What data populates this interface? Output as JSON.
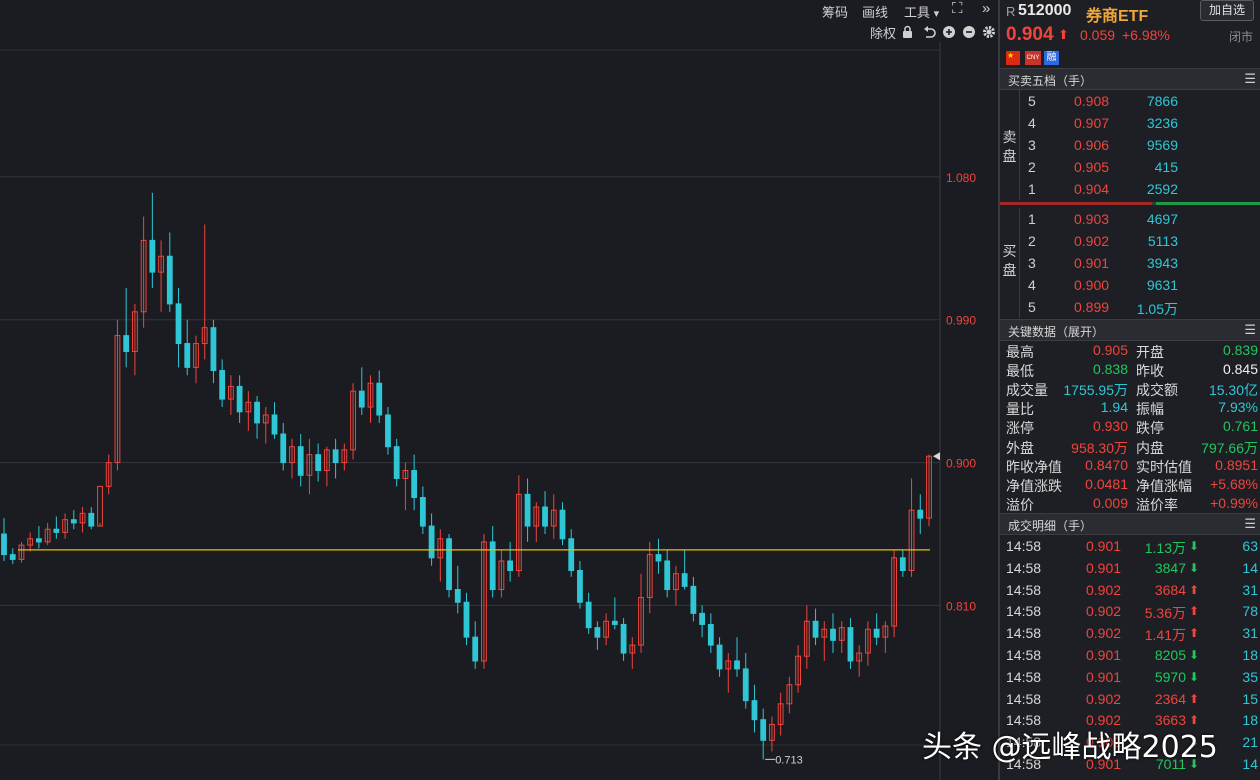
{
  "toolbar": {
    "chips": "筹码",
    "draw": "画线",
    "tools": "工具",
    "tools_arrow": "▾",
    "fullscreen_icon": "⛶",
    "more_icon": "»"
  },
  "subbar": {
    "adjust": "除权",
    "icons": [
      "lock-icon",
      "undo-icon",
      "zoom-in-icon",
      "zoom-out-icon",
      "gear-icon"
    ]
  },
  "chart_data": {
    "type": "candlestick",
    "y_ticks": [
      "1.080",
      "0.990",
      "0.900",
      "0.810"
    ],
    "y_tick_values": [
      1.08,
      0.99,
      0.9,
      0.81
    ],
    "ylim": [
      0.7,
      1.165
    ],
    "reference_price": 0.845,
    "low_marker": "0.713",
    "last_price_marker": 0.904,
    "up_color": "#f0443c",
    "down_color": "#2fc7d6",
    "ref_line_color": "#e8c000",
    "grid": true,
    "candles": [
      [
        0.855,
        0.865,
        0.838,
        0.842
      ],
      [
        0.842,
        0.846,
        0.836,
        0.839
      ],
      [
        0.839,
        0.85,
        0.837,
        0.848
      ],
      [
        0.848,
        0.856,
        0.844,
        0.852
      ],
      [
        0.852,
        0.86,
        0.846,
        0.85
      ],
      [
        0.85,
        0.862,
        0.848,
        0.858
      ],
      [
        0.858,
        0.866,
        0.852,
        0.856
      ],
      [
        0.856,
        0.868,
        0.852,
        0.864
      ],
      [
        0.864,
        0.87,
        0.858,
        0.862
      ],
      [
        0.862,
        0.872,
        0.856,
        0.868
      ],
      [
        0.868,
        0.872,
        0.858,
        0.86
      ],
      [
        0.86,
        0.862,
        0.882,
        0.885
      ],
      [
        0.885,
        0.905,
        0.88,
        0.9
      ],
      [
        0.9,
        0.99,
        0.895,
        0.98
      ],
      [
        0.98,
        1.01,
        0.96,
        0.97
      ],
      [
        0.97,
        1.0,
        0.955,
        0.995
      ],
      [
        0.995,
        1.055,
        0.985,
        1.04
      ],
      [
        1.04,
        1.07,
        1.01,
        1.02
      ],
      [
        1.02,
        1.04,
        0.995,
        1.03
      ],
      [
        1.03,
        1.045,
        0.995,
        1.0
      ],
      [
        1.0,
        1.01,
        0.96,
        0.975
      ],
      [
        0.975,
        0.99,
        0.955,
        0.96
      ],
      [
        0.96,
        0.98,
        0.95,
        0.975
      ],
      [
        0.975,
        1.05,
        0.965,
        0.985
      ],
      [
        0.985,
        0.99,
        0.95,
        0.958
      ],
      [
        0.958,
        0.965,
        0.935,
        0.94
      ],
      [
        0.94,
        0.955,
        0.93,
        0.948
      ],
      [
        0.948,
        0.955,
        0.925,
        0.932
      ],
      [
        0.932,
        0.945,
        0.92,
        0.938
      ],
      [
        0.938,
        0.942,
        0.915,
        0.925
      ],
      [
        0.925,
        0.935,
        0.912,
        0.93
      ],
      [
        0.93,
        0.938,
        0.915,
        0.918
      ],
      [
        0.918,
        0.925,
        0.895,
        0.9
      ],
      [
        0.9,
        0.915,
        0.89,
        0.91
      ],
      [
        0.91,
        0.918,
        0.885,
        0.892
      ],
      [
        0.892,
        0.915,
        0.88,
        0.905
      ],
      [
        0.905,
        0.912,
        0.888,
        0.895
      ],
      [
        0.895,
        0.91,
        0.885,
        0.908
      ],
      [
        0.908,
        0.915,
        0.89,
        0.9
      ],
      [
        0.9,
        0.912,
        0.895,
        0.908
      ],
      [
        0.908,
        0.95,
        0.902,
        0.945
      ],
      [
        0.945,
        0.96,
        0.93,
        0.935
      ],
      [
        0.935,
        0.955,
        0.925,
        0.95
      ],
      [
        0.95,
        0.958,
        0.925,
        0.93
      ],
      [
        0.93,
        0.935,
        0.905,
        0.91
      ],
      [
        0.91,
        0.915,
        0.885,
        0.89
      ],
      [
        0.89,
        0.9,
        0.87,
        0.895
      ],
      [
        0.895,
        0.905,
        0.87,
        0.878
      ],
      [
        0.878,
        0.885,
        0.855,
        0.86
      ],
      [
        0.86,
        0.868,
        0.835,
        0.84
      ],
      [
        0.84,
        0.858,
        0.825,
        0.852
      ],
      [
        0.852,
        0.855,
        0.815,
        0.82
      ],
      [
        0.82,
        0.835,
        0.805,
        0.812
      ],
      [
        0.812,
        0.818,
        0.785,
        0.79
      ],
      [
        0.79,
        0.8,
        0.77,
        0.775
      ],
      [
        0.775,
        0.855,
        0.77,
        0.85
      ],
      [
        0.85,
        0.86,
        0.815,
        0.82
      ],
      [
        0.82,
        0.845,
        0.815,
        0.838
      ],
      [
        0.838,
        0.85,
        0.825,
        0.832
      ],
      [
        0.832,
        0.892,
        0.828,
        0.88
      ],
      [
        0.88,
        0.89,
        0.85,
        0.86
      ],
      [
        0.86,
        0.875,
        0.85,
        0.872
      ],
      [
        0.872,
        0.882,
        0.855,
        0.86
      ],
      [
        0.86,
        0.88,
        0.852,
        0.87
      ],
      [
        0.87,
        0.875,
        0.848,
        0.852
      ],
      [
        0.852,
        0.858,
        0.828,
        0.832
      ],
      [
        0.832,
        0.838,
        0.808,
        0.812
      ],
      [
        0.812,
        0.818,
        0.792,
        0.796
      ],
      [
        0.796,
        0.8,
        0.782,
        0.79
      ],
      [
        0.79,
        0.805,
        0.785,
        0.8
      ],
      [
        0.8,
        0.815,
        0.795,
        0.798
      ],
      [
        0.798,
        0.802,
        0.775,
        0.78
      ],
      [
        0.78,
        0.79,
        0.77,
        0.785
      ],
      [
        0.785,
        0.83,
        0.78,
        0.815
      ],
      [
        0.815,
        0.85,
        0.805,
        0.842
      ],
      [
        0.842,
        0.852,
        0.83,
        0.838
      ],
      [
        0.838,
        0.845,
        0.815,
        0.82
      ],
      [
        0.82,
        0.835,
        0.81,
        0.83
      ],
      [
        0.83,
        0.845,
        0.82,
        0.822
      ],
      [
        0.822,
        0.828,
        0.8,
        0.805
      ],
      [
        0.805,
        0.81,
        0.79,
        0.798
      ],
      [
        0.798,
        0.805,
        0.78,
        0.785
      ],
      [
        0.785,
        0.79,
        0.765,
        0.77
      ],
      [
        0.77,
        0.78,
        0.755,
        0.775
      ],
      [
        0.775,
        0.79,
        0.765,
        0.77
      ],
      [
        0.77,
        0.78,
        0.745,
        0.75
      ],
      [
        0.75,
        0.76,
        0.73,
        0.738
      ],
      [
        0.738,
        0.745,
        0.713,
        0.725
      ],
      [
        0.725,
        0.74,
        0.718,
        0.735
      ],
      [
        0.735,
        0.755,
        0.728,
        0.748
      ],
      [
        0.748,
        0.765,
        0.742,
        0.76
      ],
      [
        0.76,
        0.785,
        0.755,
        0.778
      ],
      [
        0.778,
        0.81,
        0.77,
        0.8
      ],
      [
        0.8,
        0.808,
        0.785,
        0.79
      ],
      [
        0.79,
        0.8,
        0.775,
        0.795
      ],
      [
        0.795,
        0.805,
        0.78,
        0.788
      ],
      [
        0.788,
        0.8,
        0.78,
        0.796
      ],
      [
        0.796,
        0.802,
        0.77,
        0.775
      ],
      [
        0.775,
        0.785,
        0.765,
        0.78
      ],
      [
        0.78,
        0.8,
        0.772,
        0.795
      ],
      [
        0.795,
        0.805,
        0.785,
        0.79
      ],
      [
        0.79,
        0.8,
        0.78,
        0.797
      ],
      [
        0.797,
        0.845,
        0.79,
        0.84
      ],
      [
        0.84,
        0.845,
        0.828,
        0.832
      ],
      [
        0.832,
        0.89,
        0.828,
        0.87
      ],
      [
        0.87,
        0.88,
        0.855,
        0.865
      ],
      [
        0.865,
        0.905,
        0.86,
        0.904
      ]
    ]
  },
  "quote": {
    "market_tag": "R",
    "code": "512000",
    "name": "券商ETF",
    "add_watch": "加自选",
    "price": "0.904",
    "arrow": "⬆",
    "change": "0.059",
    "change_pct": "+6.98%",
    "status": "闭市",
    "badges": [
      "flag-cn-icon",
      "CNY",
      "融"
    ]
  },
  "order_book": {
    "title": "买卖五档（手）",
    "sell_label": [
      "卖",
      "盘"
    ],
    "buy_label": [
      "买",
      "盘"
    ],
    "sells": [
      {
        "lvl": "5",
        "price": "0.908",
        "vol": "7866"
      },
      {
        "lvl": "4",
        "price": "0.907",
        "vol": "3236"
      },
      {
        "lvl": "3",
        "price": "0.906",
        "vol": "9569"
      },
      {
        "lvl": "2",
        "price": "0.905",
        "vol": "415"
      },
      {
        "lvl": "1",
        "price": "0.904",
        "vol": "2592"
      }
    ],
    "buys": [
      {
        "lvl": "1",
        "price": "0.903",
        "vol": "4697"
      },
      {
        "lvl": "2",
        "price": "0.902",
        "vol": "5113"
      },
      {
        "lvl": "3",
        "price": "0.901",
        "vol": "3943"
      },
      {
        "lvl": "4",
        "price": "0.900",
        "vol": "9631"
      },
      {
        "lvl": "5",
        "price": "0.899",
        "vol": "1.05万"
      }
    ]
  },
  "key_data": {
    "title": "关键数据（展开）",
    "rows": [
      {
        "l1": "最高",
        "v1": "0.905",
        "c1": "red",
        "l2": "开盘",
        "v2": "0.839",
        "c2": "green"
      },
      {
        "l1": "最低",
        "v1": "0.838",
        "c1": "green",
        "l2": "昨收",
        "v2": "0.845",
        "c2": "white"
      },
      {
        "l1": "成交量",
        "v1": "1755.95万",
        "c1": "cyan",
        "l2": "成交额",
        "v2": "15.30亿",
        "c2": "cyan"
      },
      {
        "l1": "量比",
        "v1": "1.94",
        "c1": "cyan",
        "l2": "振幅",
        "v2": "7.93%",
        "c2": "cyan"
      },
      {
        "l1": "涨停",
        "v1": "0.930",
        "c1": "red",
        "l2": "跌停",
        "v2": "0.761",
        "c2": "green"
      },
      {
        "l1": "外盘",
        "v1": "958.30万",
        "c1": "red",
        "l2": "内盘",
        "v2": "797.66万",
        "c2": "green"
      },
      {
        "l1": "昨收净值",
        "v1": "0.8470",
        "c1": "red",
        "l2": "实时估值",
        "v2": "0.8951",
        "c2": "red"
      },
      {
        "l1": "净值涨跌",
        "v1": "0.0481",
        "c1": "red",
        "l2": "净值涨幅",
        "v2": "+5.68%",
        "c2": "red"
      },
      {
        "l1": "溢价",
        "v1": "0.009",
        "c1": "red",
        "l2": "溢价率",
        "v2": "+0.99%",
        "c2": "red"
      }
    ]
  },
  "trades": {
    "title": "成交明细（手）",
    "rows": [
      {
        "time": "14:58",
        "price": "0.901",
        "pc": "red",
        "vol": "1.13万",
        "dir": "down",
        "num": "63"
      },
      {
        "time": "14:58",
        "price": "0.901",
        "pc": "red",
        "vol": "3847",
        "dir": "down",
        "num": "14"
      },
      {
        "time": "14:58",
        "price": "0.902",
        "pc": "red",
        "vol": "3684",
        "dir": "up",
        "num": "31"
      },
      {
        "time": "14:58",
        "price": "0.902",
        "pc": "red",
        "vol": "5.36万",
        "dir": "up",
        "num": "78"
      },
      {
        "time": "14:58",
        "price": "0.902",
        "pc": "red",
        "vol": "1.41万",
        "dir": "up",
        "num": "31"
      },
      {
        "time": "14:58",
        "price": "0.901",
        "pc": "red",
        "vol": "8205",
        "dir": "down",
        "num": "18"
      },
      {
        "time": "14:58",
        "price": "0.901",
        "pc": "red",
        "vol": "5970",
        "dir": "down",
        "num": "35"
      },
      {
        "time": "14:58",
        "price": "0.902",
        "pc": "red",
        "vol": "2364",
        "dir": "up",
        "num": "15"
      },
      {
        "time": "14:58",
        "price": "0.902",
        "pc": "red",
        "vol": "3663",
        "dir": "up",
        "num": "18"
      },
      {
        "time": "14:58",
        "price": "0.902",
        "pc": "red",
        "vol": "",
        "dir": "down",
        "num": "21"
      },
      {
        "time": "14:58",
        "price": "0.901",
        "pc": "red",
        "vol": "7011",
        "dir": "down",
        "num": "14"
      }
    ]
  },
  "watermark": "头条 @远峰战略2025"
}
